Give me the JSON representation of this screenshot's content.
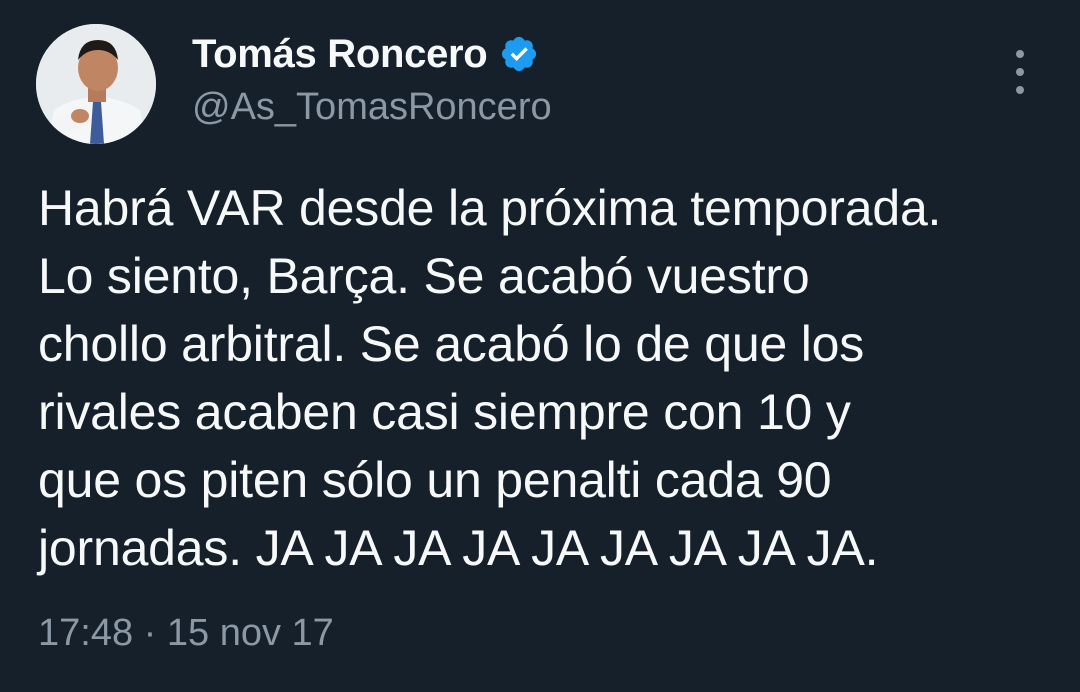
{
  "author": {
    "display_name": "Tomás Roncero",
    "handle": "@As_TomasRoncero",
    "verified": true,
    "verified_icon": "verified-badge-icon",
    "verified_color": "#1d9bf0",
    "avatar_icon": "profile-photo"
  },
  "menu_icon": "more-options-icon",
  "tweet": {
    "text": "Habrá VAR desde la próxima temporada.\nLo siento, Barça. Se acabó vuestro\nchollo arbitral. Se acabó lo de que los\nrivales acaben casi siempre con 10 y\nque os piten sólo un penalti cada 90\njornadas. JA JA JA JA JA JA JA JA JA.",
    "timestamp": "17:48 · 15 nov 17"
  },
  "colors": {
    "background": "#15202b",
    "primary_text": "#f7f9f9",
    "secondary_text": "#8b98a5"
  }
}
